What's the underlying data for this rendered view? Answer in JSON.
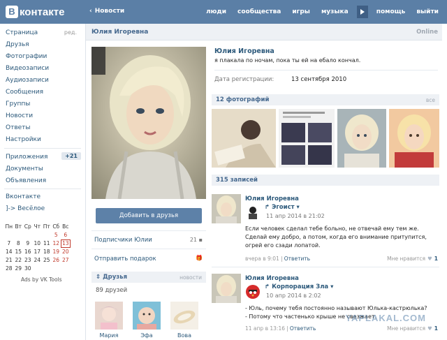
{
  "header": {
    "logo_mark": "В",
    "logo_text": "контакте",
    "back_label": "Новости",
    "nav": [
      "люди",
      "сообщества",
      "игры",
      "музыка",
      "помощь",
      "выйти"
    ]
  },
  "sidebar": {
    "items": [
      {
        "label": "Страница",
        "extra": "ред."
      },
      {
        "label": "Друзья"
      },
      {
        "label": "Фотографии"
      },
      {
        "label": "Видеозаписи"
      },
      {
        "label": "Аудиозаписи"
      },
      {
        "label": "Сообщения"
      },
      {
        "label": "Группы"
      },
      {
        "label": "Новости"
      },
      {
        "label": "Ответы"
      },
      {
        "label": "Настройки"
      }
    ],
    "apps": {
      "label": "Приложения",
      "badge": "+21"
    },
    "docs": "Документы",
    "ads_link": "Объявления",
    "vk": "Вконтакте",
    "fun": "]-> Весёлое",
    "calendar": {
      "weekdays": [
        "Пн",
        "Вт",
        "Ср",
        "Чт",
        "Пт",
        "Сб",
        "Вс"
      ],
      "weeks": [
        [
          "",
          "",
          "",
          "",
          "",
          "5",
          "6"
        ],
        [
          "7",
          "8",
          "9",
          "10",
          "11",
          "12",
          "13"
        ],
        [
          "14",
          "15",
          "16",
          "17",
          "18",
          "19",
          "20"
        ],
        [
          "21",
          "22",
          "23",
          "24",
          "25",
          "26",
          "27"
        ],
        [
          "28",
          "29",
          "30",
          "",
          "",
          "",
          ""
        ]
      ],
      "today": "13"
    },
    "ads_by": "Ads by VK Tools"
  },
  "profile": {
    "header_name": "Юлия Игоревна",
    "online": "Online",
    "name": "Юлия Игоревна",
    "status": "я плакала по ночам, пока ты ей на ебало кончал.",
    "reg_label": "Дата регистрации:",
    "reg_value": "13 сентября 2010",
    "add_friend": "Добавить в друзья",
    "subscribers_label": "Подписчики Юлии",
    "subscribers_count": "21",
    "gift_label": "Отправить подарок",
    "friends_title": "Друзья",
    "friends_link": "новости",
    "friends_count": "89 друзей",
    "friends": [
      {
        "name": "Мария"
      },
      {
        "name": "Эфа"
      },
      {
        "name": "Вова"
      }
    ],
    "photos_title": "12 фотографий",
    "photos_link": "все",
    "posts_title": "315 записей"
  },
  "posts": [
    {
      "author": "Юлия Игоревна",
      "repost_author": "Эгоист",
      "repost_date": "11 апр 2014 в 21:02",
      "text": [
        "Если человек сделал тебе больно, не отвечай ему тем же.",
        "Сделай ему добро, а потом, когда его внимание притупится,",
        "огрей его сзади лопатой."
      ],
      "meta": "вчера в 9:01 |",
      "reply": "Ответить",
      "like_label": "Мне нравится",
      "likes": "1"
    },
    {
      "author": "Юлия Игоревна",
      "repost_author": "Корпорация Зла",
      "repost_date": "10 апр 2014 в 2:02",
      "text": [
        "- Юль, почему тебя постоянно называют Юлька-кастрюлька?",
        "- Потому что частенько крыше не свезжает."
      ],
      "meta": "11 апр в 13:16 |",
      "reply": "Ответить",
      "like_label": "Мне нравится",
      "likes": "1"
    }
  ],
  "watermark": "YAPLAKAL.COM",
  "colors": {
    "topbar": "#5b7fa6",
    "link": "#2b587a",
    "header_bg": "#eef1f5",
    "button": "#5d81a8"
  }
}
